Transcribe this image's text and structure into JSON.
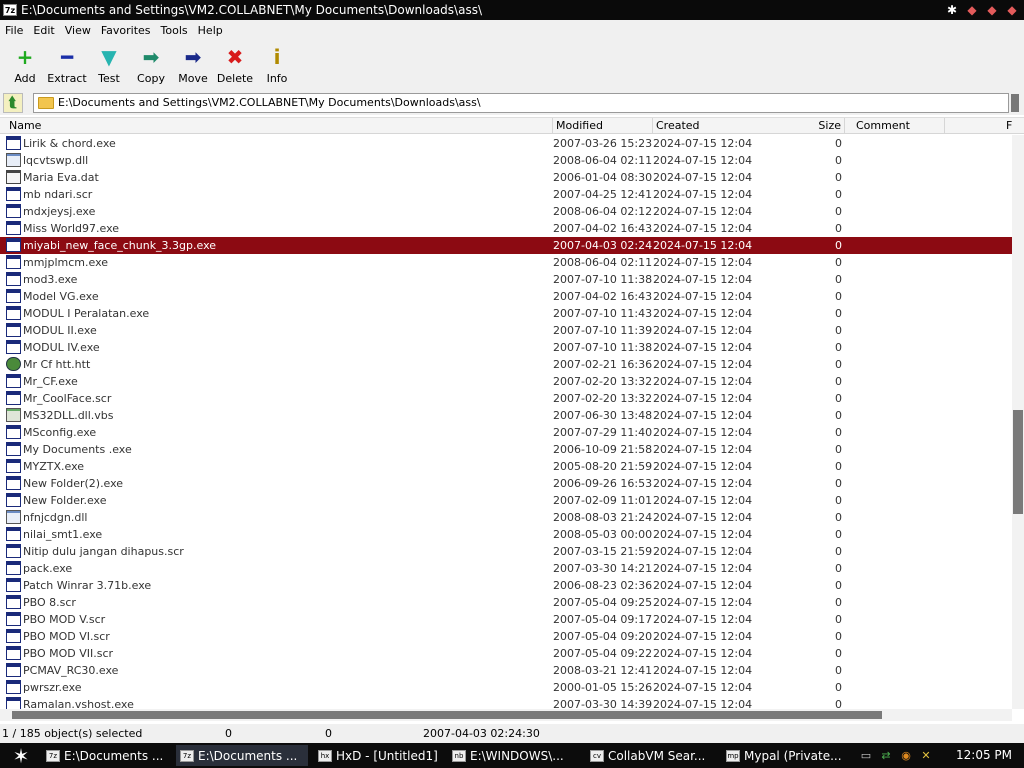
{
  "window": {
    "title": "E:\\Documents and Settings\\VM2.COLLABNET\\My Documents\\Downloads\\ass\\",
    "app_icon_text": "7z"
  },
  "menu": [
    "File",
    "Edit",
    "View",
    "Favorites",
    "Tools",
    "Help"
  ],
  "toolbar": [
    {
      "label": "Add",
      "icon": "plus-icon",
      "symbol": "+",
      "color": "#1faa1f"
    },
    {
      "label": "Extract",
      "icon": "minus-icon",
      "symbol": "━",
      "color": "#1a2ea8"
    },
    {
      "label": "Test",
      "icon": "check-arrow-icon",
      "symbol": "▼",
      "color": "#27b4b0"
    },
    {
      "label": "Copy",
      "icon": "copy-arrow-icon",
      "symbol": "➡",
      "color": "#1f8a6a"
    },
    {
      "label": "Move",
      "icon": "move-arrow-icon",
      "symbol": "➡",
      "color": "#1a2a8a"
    },
    {
      "label": "Delete",
      "icon": "delete-x-icon",
      "symbol": "✖",
      "color": "#d81b1b"
    },
    {
      "label": "Info",
      "icon": "info-icon",
      "symbol": "i",
      "color": "#b08a00"
    }
  ],
  "address": {
    "path": "E:\\Documents and Settings\\VM2.COLLABNET\\My Documents\\Downloads\\ass\\"
  },
  "columns": {
    "name": "Name",
    "modified": "Modified",
    "created": "Created",
    "size": "Size",
    "comment": "Comment",
    "extra": "F"
  },
  "files": [
    {
      "name": "Lirik & chord.exe",
      "modified": "2007-03-26 15:23",
      "created": "2024-07-15 12:04",
      "size": "0",
      "type": "exe"
    },
    {
      "name": "lqcvtswp.dll",
      "modified": "2008-06-04 02:11",
      "created": "2024-07-15 12:04",
      "size": "0",
      "type": "dll"
    },
    {
      "name": "Maria Eva.dat",
      "modified": "2006-01-04 08:30",
      "created": "2024-07-15 12:04",
      "size": "0",
      "type": "dat"
    },
    {
      "name": "mb ndari.scr",
      "modified": "2007-04-25 12:41",
      "created": "2024-07-15 12:04",
      "size": "0",
      "type": "exe"
    },
    {
      "name": "mdxjeysj.exe",
      "modified": "2008-06-04 02:12",
      "created": "2024-07-15 12:04",
      "size": "0",
      "type": "exe"
    },
    {
      "name": "Miss World97.exe",
      "modified": "2007-04-02 16:43",
      "created": "2024-07-15 12:04",
      "size": "0",
      "type": "exe"
    },
    {
      "name": "miyabi_new_face_chunk_3.3gp.exe",
      "modified": "2007-04-03 02:24",
      "created": "2024-07-15 12:04",
      "size": "0",
      "type": "exe",
      "selected": true
    },
    {
      "name": "mmjplmcm.exe",
      "modified": "2008-06-04 02:11",
      "created": "2024-07-15 12:04",
      "size": "0",
      "type": "exe"
    },
    {
      "name": "mod3.exe",
      "modified": "2007-07-10 11:38",
      "created": "2024-07-15 12:04",
      "size": "0",
      "type": "exe"
    },
    {
      "name": "Model VG.exe",
      "modified": "2007-04-02 16:43",
      "created": "2024-07-15 12:04",
      "size": "0",
      "type": "exe"
    },
    {
      "name": "MODUL I Peralatan.exe",
      "modified": "2007-07-10 11:43",
      "created": "2024-07-15 12:04",
      "size": "0",
      "type": "exe"
    },
    {
      "name": "MODUL II.exe",
      "modified": "2007-07-10 11:39",
      "created": "2024-07-15 12:04",
      "size": "0",
      "type": "exe"
    },
    {
      "name": "MODUL IV.exe",
      "modified": "2007-07-10 11:38",
      "created": "2024-07-15 12:04",
      "size": "0",
      "type": "exe"
    },
    {
      "name": "Mr Cf htt.htt",
      "modified": "2007-02-21 16:36",
      "created": "2024-07-15 12:04",
      "size": "0",
      "type": "htt"
    },
    {
      "name": "Mr_CF.exe",
      "modified": "2007-02-20 13:32",
      "created": "2024-07-15 12:04",
      "size": "0",
      "type": "exe"
    },
    {
      "name": "Mr_CoolFace.scr",
      "modified": "2007-02-20 13:32",
      "created": "2024-07-15 12:04",
      "size": "0",
      "type": "exe"
    },
    {
      "name": "MS32DLL.dll.vbs",
      "modified": "2007-06-30 13:48",
      "created": "2024-07-15 12:04",
      "size": "0",
      "type": "vbs"
    },
    {
      "name": "MSconfig.exe",
      "modified": "2007-07-29 11:40",
      "created": "2024-07-15 12:04",
      "size": "0",
      "type": "exe"
    },
    {
      "name": "My Documents .exe",
      "modified": "2006-10-09 21:58",
      "created": "2024-07-15 12:04",
      "size": "0",
      "type": "exe"
    },
    {
      "name": "MYZTX.exe",
      "modified": "2005-08-20 21:59",
      "created": "2024-07-15 12:04",
      "size": "0",
      "type": "exe"
    },
    {
      "name": "New Folder(2).exe",
      "modified": "2006-09-26 16:53",
      "created": "2024-07-15 12:04",
      "size": "0",
      "type": "exe"
    },
    {
      "name": "New Folder.exe",
      "modified": "2007-02-09 11:01",
      "created": "2024-07-15 12:04",
      "size": "0",
      "type": "exe"
    },
    {
      "name": "nfnjcdgn.dll",
      "modified": "2008-08-03 21:24",
      "created": "2024-07-15 12:04",
      "size": "0",
      "type": "dll"
    },
    {
      "name": "nilai_smt1.exe",
      "modified": "2008-05-03 00:00",
      "created": "2024-07-15 12:04",
      "size": "0",
      "type": "exe"
    },
    {
      "name": "Nitip dulu jangan dihapus.scr",
      "modified": "2007-03-15 21:59",
      "created": "2024-07-15 12:04",
      "size": "0",
      "type": "exe"
    },
    {
      "name": "pack.exe",
      "modified": "2007-03-30 14:21",
      "created": "2024-07-15 12:04",
      "size": "0",
      "type": "exe"
    },
    {
      "name": "Patch Winrar 3.71b.exe",
      "modified": "2006-08-23 02:36",
      "created": "2024-07-15 12:04",
      "size": "0",
      "type": "exe"
    },
    {
      "name": "PBO 8.scr",
      "modified": "2007-05-04 09:25",
      "created": "2024-07-15 12:04",
      "size": "0",
      "type": "exe"
    },
    {
      "name": "PBO MOD V.scr",
      "modified": "2007-05-04 09:17",
      "created": "2024-07-15 12:04",
      "size": "0",
      "type": "exe"
    },
    {
      "name": "PBO MOD VI.scr",
      "modified": "2007-05-04 09:20",
      "created": "2024-07-15 12:04",
      "size": "0",
      "type": "exe"
    },
    {
      "name": "PBO MOD VII.scr",
      "modified": "2007-05-04 09:22",
      "created": "2024-07-15 12:04",
      "size": "0",
      "type": "exe"
    },
    {
      "name": "PCMAV_RC30.exe",
      "modified": "2008-03-21 12:41",
      "created": "2024-07-15 12:04",
      "size": "0",
      "type": "exe"
    },
    {
      "name": "pwrszr.exe",
      "modified": "2000-01-05 15:26",
      "created": "2024-07-15 12:04",
      "size": "0",
      "type": "exe"
    },
    {
      "name": "Ramalan.vshost.exe",
      "modified": "2007-03-30 14:39",
      "created": "2024-07-15 12:04",
      "size": "0",
      "type": "exe"
    }
  ],
  "status": {
    "selection": "1 / 185 object(s) selected",
    "size1": "0",
    "size2": "0",
    "modified": "2007-04-03 02:24:30"
  },
  "taskbar": {
    "tasks": [
      {
        "label": "E:\\Documents ...",
        "icon": "7z",
        "active": false
      },
      {
        "label": "E:\\Documents ...",
        "icon": "7z",
        "active": true
      },
      {
        "label": "HxD - [Untitled1]",
        "icon": "hx",
        "active": false
      },
      {
        "label": "E:\\WINDOWS\\...",
        "icon": "nb",
        "active": false
      },
      {
        "label": "CollabVM Sear...",
        "icon": "cv",
        "active": false
      },
      {
        "label": "Mypal (Private...",
        "icon": "mp",
        "active": false
      }
    ],
    "clock": "12:05 PM"
  },
  "colors": {
    "selected_row": "#8c0a12",
    "title_bar": "#0a0a0a"
  }
}
